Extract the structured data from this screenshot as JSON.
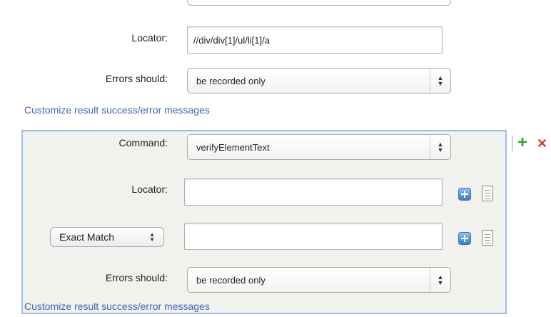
{
  "top_step": {
    "locator_label": "Locator:",
    "locator_value": "//div/div[1]/ul/li[1]/a",
    "errors_label": "Errors should:",
    "errors_value": "be recorded only",
    "customize_link": "Customize result success/error messages"
  },
  "active_step": {
    "command_label": "Command:",
    "command_value": "verifyElementText",
    "locator_label": "Locator:",
    "locator_value": "",
    "match_mode": "Exact Match",
    "match_value": "",
    "errors_label": "Errors should:",
    "errors_value": "be recorded only",
    "customize_link": "Customize result success/error messages"
  },
  "step_actions": {
    "add_symbol": "+",
    "delete_symbol": "✕"
  },
  "icons": [
    "add-variable-icon",
    "document-icon",
    "plus-icon",
    "delete-icon"
  ],
  "colors": {
    "link": "#3f67b0",
    "panel_border": "#9ebde2",
    "panel_bg": "#f1f1ee",
    "add_green": "#3aa235",
    "delete_red": "#d83a2a"
  }
}
